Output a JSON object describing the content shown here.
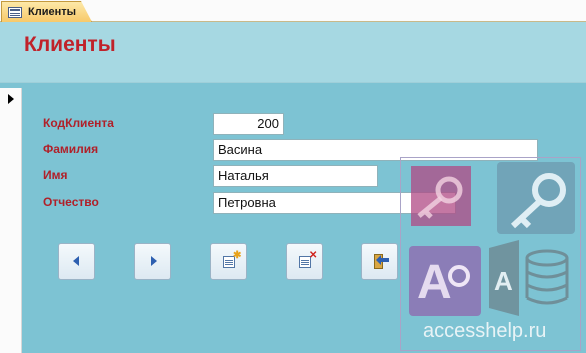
{
  "tab": {
    "label": "Клиенты",
    "icon": "form-icon"
  },
  "form": {
    "title": "Клиенты"
  },
  "fields": [
    {
      "label": "КодКлиента",
      "value": "200"
    },
    {
      "label": "Фамилия",
      "value": "Васина"
    },
    {
      "label": "Имя",
      "value": "Наталья"
    },
    {
      "label": "Отчество",
      "value": "Петровна"
    }
  ],
  "nav_buttons": [
    {
      "name": "previous-record",
      "icon": "arrow-left-icon"
    },
    {
      "name": "next-record",
      "icon": "arrow-right-icon"
    },
    {
      "name": "new-record",
      "icon": "new-record-icon"
    },
    {
      "name": "delete-record",
      "icon": "delete-record-icon"
    },
    {
      "name": "close-form",
      "icon": "exit-door-icon"
    }
  ],
  "watermark": {
    "logo": "access-logo",
    "text": "accesshelp.ru"
  },
  "colors": {
    "header_bg": "#a6d8e2",
    "body_bg": "#7dc3d3",
    "title": "#c0222a",
    "label": "#b02029",
    "tab_accent": "#f7c96a"
  }
}
